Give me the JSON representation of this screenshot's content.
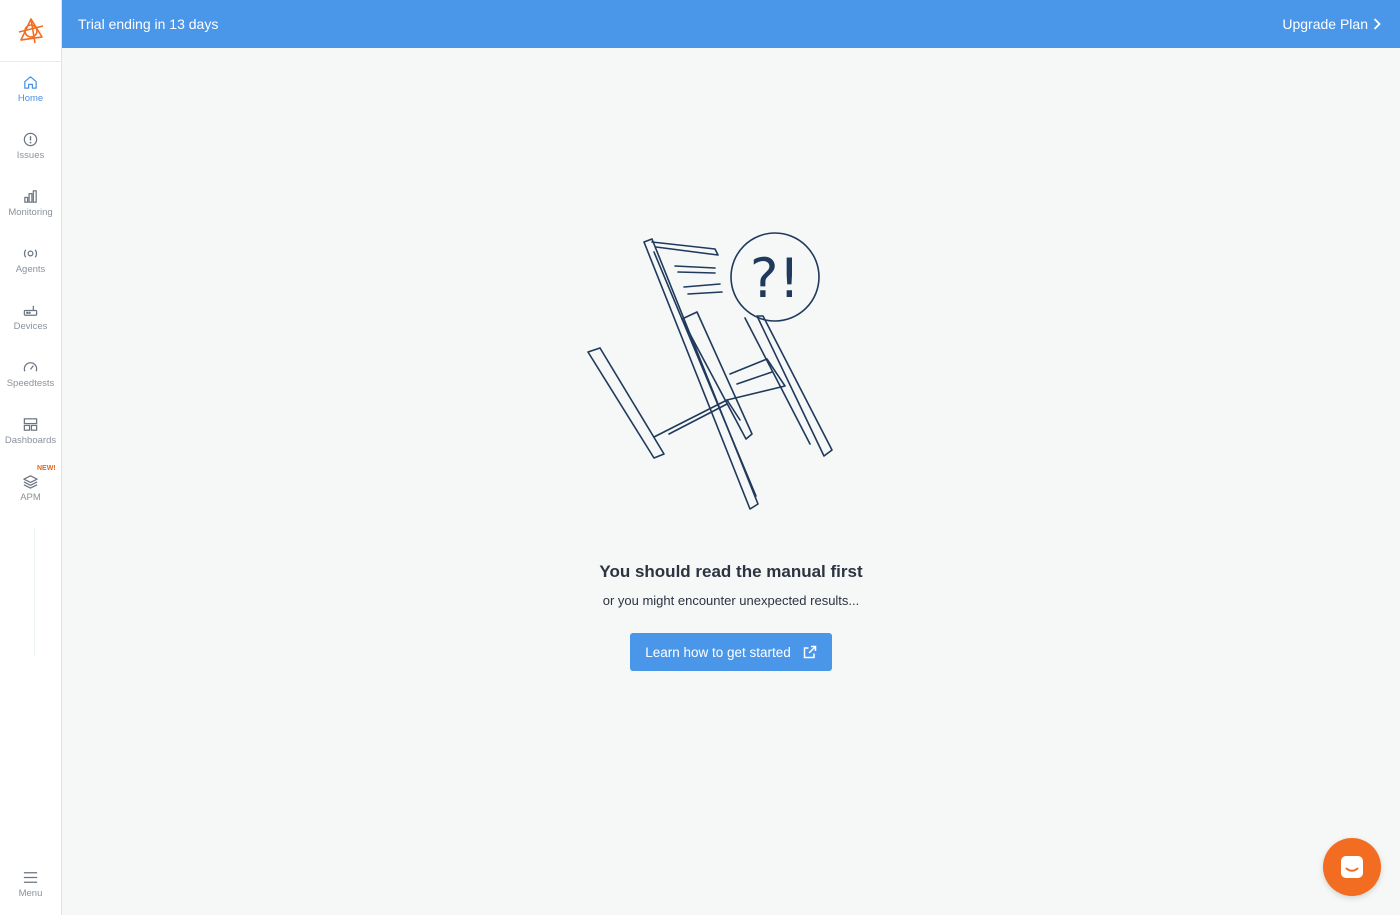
{
  "banner": {
    "trial_text": "Trial ending in 13 days",
    "upgrade_label": "Upgrade Plan"
  },
  "sidebar": {
    "items": [
      {
        "label": "Home",
        "icon": "home-icon",
        "active": true
      },
      {
        "label": "Issues",
        "icon": "alert-circle-icon",
        "active": false
      },
      {
        "label": "Monitoring",
        "icon": "bar-chart-icon",
        "active": false
      },
      {
        "label": "Agents",
        "icon": "agent-icon",
        "active": false
      },
      {
        "label": "Devices",
        "icon": "router-icon",
        "active": false
      },
      {
        "label": "Speedtests",
        "icon": "speedometer-icon",
        "active": false
      },
      {
        "label": "Dashboards",
        "icon": "dashboard-icon",
        "active": false
      },
      {
        "label": "APM",
        "icon": "layers-icon",
        "active": false,
        "badge": "NEW!"
      }
    ],
    "menu_label": "Menu"
  },
  "main": {
    "headline": "You should read the manual first",
    "subline": "or you might encounter unexpected results...",
    "cta_label": "Learn how to get started",
    "illustration_text": "?!"
  },
  "colors": {
    "accent": "#4a96e8",
    "brand": "#f26d22",
    "ink": "#1f3a5c"
  }
}
